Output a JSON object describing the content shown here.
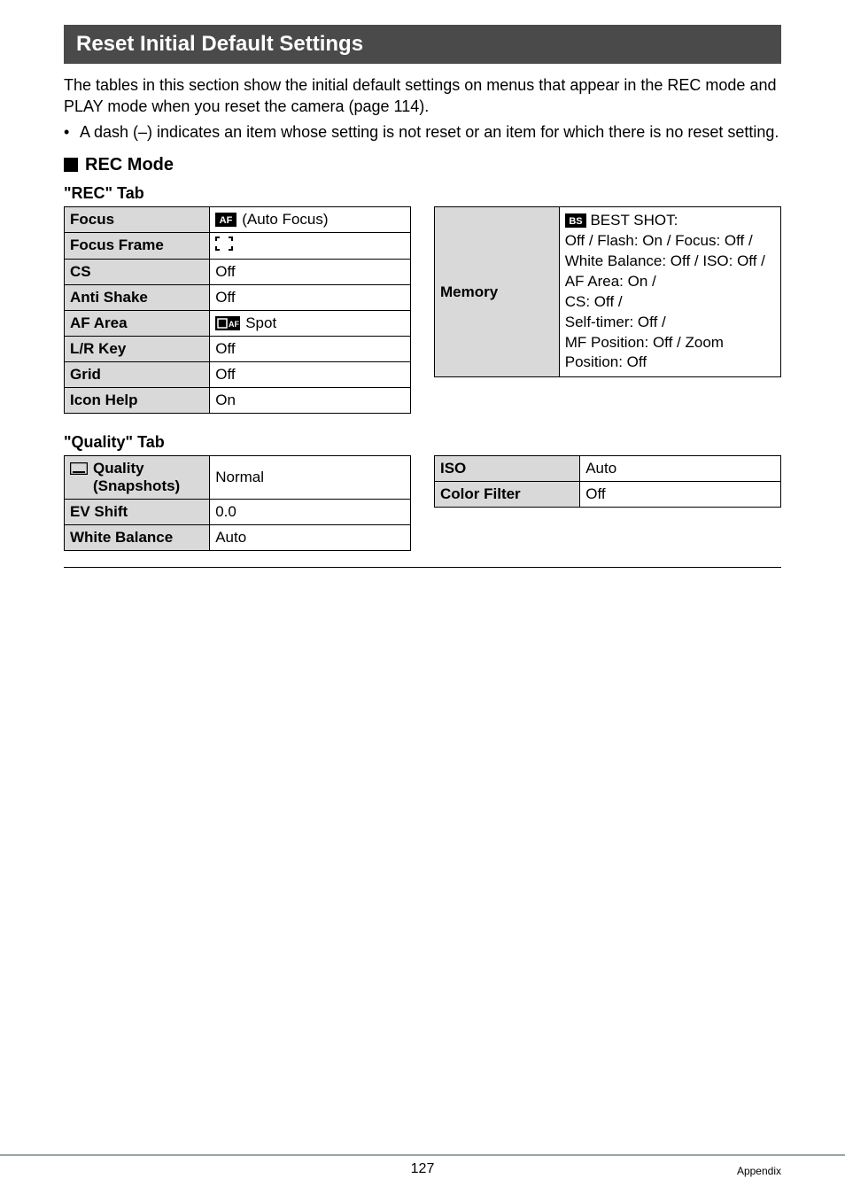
{
  "banner": "Reset Initial Default Settings",
  "intro": "The tables in this section show the initial default settings on menus that appear in the REC mode and PLAY mode when you reset the camera (page 114).",
  "bullet": "A dash (–) indicates an item whose setting is not reset or an item for which there is no reset setting.",
  "rec_mode_heading": "REC Mode",
  "rec_tab_heading": "\"REC\" Tab",
  "quality_tab_heading": "\"Quality\" Tab",
  "rec_left": [
    {
      "label": "Focus",
      "icon": "af-icon",
      "value": " (Auto Focus)"
    },
    {
      "label": "Focus Frame",
      "icon": "focus-frame-icon",
      "value": ""
    },
    {
      "label": "CS",
      "value": "Off"
    },
    {
      "label": "Anti Shake",
      "value": "Off"
    },
    {
      "label": "AF Area",
      "icon": "spot-icon",
      "value": " Spot"
    },
    {
      "label": "L/R Key",
      "value": "Off"
    },
    {
      "label": "Grid",
      "value": "Off"
    },
    {
      "label": "Icon Help",
      "value": "On"
    }
  ],
  "memory": {
    "label": "Memory",
    "icon_text": " BEST SHOT:",
    "lines": "Off / Flash: On / Focus: Off /\nWhite Balance: Off / ISO: Off /\nAF Area: On /\nCS: Off /\nSelf-timer: Off /\nMF Position: Off / Zoom Position: Off"
  },
  "quality_left": [
    {
      "label_icon": "snapshot-icon",
      "label_text": " Quality (Snapshots)",
      "value": "Normal"
    },
    {
      "label": "EV Shift",
      "value": "0.0"
    },
    {
      "label": "White Balance",
      "value": "Auto"
    }
  ],
  "quality_right": [
    {
      "label": "ISO",
      "value": "Auto"
    },
    {
      "label": "Color Filter",
      "value": "Off"
    }
  ],
  "footer": {
    "page": "127",
    "section": "Appendix"
  },
  "chart_data": {
    "type": "table",
    "title": "Reset Initial Default Settings",
    "tables": [
      {
        "name": "REC Tab (left)",
        "rows": [
          [
            "Focus",
            "AF (Auto Focus)"
          ],
          [
            "Focus Frame",
            "[ ] (default frame)"
          ],
          [
            "CS",
            "Off"
          ],
          [
            "Anti Shake",
            "Off"
          ],
          [
            "AF Area",
            "Spot"
          ],
          [
            "L/R Key",
            "Off"
          ],
          [
            "Grid",
            "Off"
          ],
          [
            "Icon Help",
            "On"
          ]
        ]
      },
      {
        "name": "REC Tab (right)",
        "rows": [
          [
            "Memory",
            "BS BEST SHOT: Off / Flash: On / Focus: Off / White Balance: Off / ISO: Off / AF Area: On / CS: Off / Self-timer: Off / MF Position: Off / Zoom Position: Off"
          ]
        ]
      },
      {
        "name": "Quality Tab (left)",
        "rows": [
          [
            "Quality (Snapshots)",
            "Normal"
          ],
          [
            "EV Shift",
            "0.0"
          ],
          [
            "White Balance",
            "Auto"
          ]
        ]
      },
      {
        "name": "Quality Tab (right)",
        "rows": [
          [
            "ISO",
            "Auto"
          ],
          [
            "Color Filter",
            "Off"
          ]
        ]
      }
    ]
  }
}
